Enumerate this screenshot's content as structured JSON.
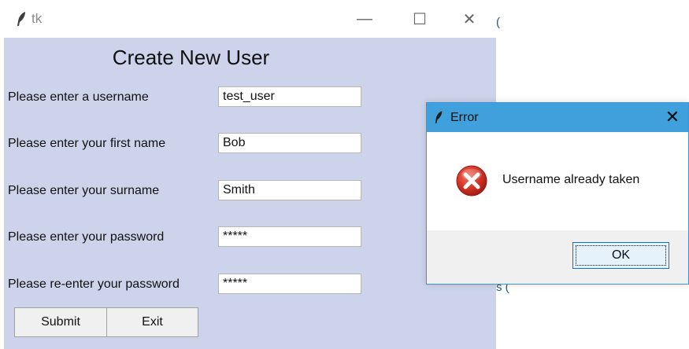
{
  "main_window": {
    "title": "tk",
    "controls": {
      "minimize": "—",
      "maximize": "☐",
      "close": "✕"
    },
    "heading": "Create New User",
    "fields": [
      {
        "label": "Please enter a username",
        "value": "test_user"
      },
      {
        "label": "Please enter your first name",
        "value": "Bob"
      },
      {
        "label": "Please enter your surname",
        "value": "Smith"
      },
      {
        "label": "Please enter your password",
        "value": "*****"
      },
      {
        "label": "Please re-enter your password",
        "value": "*****"
      }
    ],
    "buttons": {
      "submit": "Submit",
      "exit": "Exit"
    },
    "background_color": "#ccd3ea"
  },
  "background_fragments": {
    "top_glyph": "(",
    "bottom_glyph": "s ("
  },
  "dialog": {
    "title": "Error",
    "close": "✕",
    "message": "Username already taken",
    "ok_label": "OK",
    "icon": "error-icon",
    "titlebar_color": "#3fa0dc"
  }
}
